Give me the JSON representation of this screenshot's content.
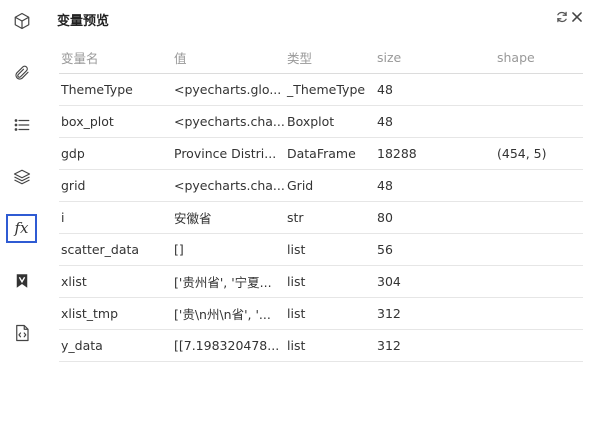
{
  "panel": {
    "title": "变量预览"
  },
  "sidebar": {
    "items": [
      {
        "icon": "cube-icon"
      },
      {
        "icon": "paperclip-icon"
      },
      {
        "icon": "list-icon"
      },
      {
        "icon": "layers-icon"
      },
      {
        "icon": "fx-icon",
        "label": "fx",
        "active": true
      },
      {
        "icon": "bookmark-v-icon"
      },
      {
        "icon": "code-file-icon"
      }
    ]
  },
  "table": {
    "headers": [
      "变量名",
      "值",
      "类型",
      "size",
      "shape"
    ],
    "rows": [
      [
        "ThemeType",
        "<pyecharts.glo...",
        "_ThemeType",
        "48",
        ""
      ],
      [
        "box_plot",
        "<pyecharts.cha...",
        "Boxplot",
        "48",
        ""
      ],
      [
        "gdp",
        "Province Distri...",
        "DataFrame",
        "18288",
        "(454, 5)"
      ],
      [
        "grid",
        "<pyecharts.cha...",
        "Grid",
        "48",
        ""
      ],
      [
        "i",
        "安徽省",
        "str",
        "80",
        ""
      ],
      [
        "scatter_data",
        "[]",
        "list",
        "56",
        ""
      ],
      [
        "xlist",
        "['贵州省', '宁夏...",
        "list",
        "304",
        ""
      ],
      [
        "xlist_tmp",
        "['贵\\n州\\n省', '...",
        "list",
        "312",
        ""
      ],
      [
        "y_data",
        "[[7.198320478...",
        "list",
        "312",
        ""
      ]
    ]
  },
  "colors": {
    "accent": "#2f5bd3",
    "header_text": "#999999",
    "divider": "#e6e6e6"
  }
}
